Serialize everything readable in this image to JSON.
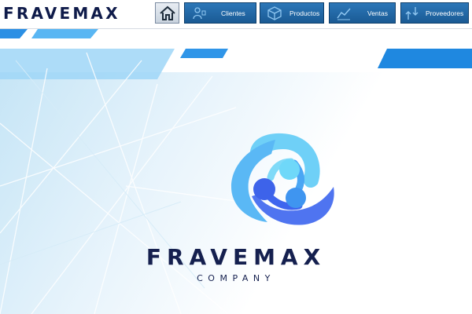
{
  "app": {
    "brand": "FRAVEMAX"
  },
  "nav": {
    "home_icon": "home-icon",
    "buttons": [
      {
        "label": "Clientes",
        "icon": "clients-icon"
      },
      {
        "label": "Productos",
        "icon": "box-icon"
      },
      {
        "label": "Ventas",
        "icon": "chart-icon"
      },
      {
        "label": "Proveedores",
        "icon": "suppliers-icon"
      }
    ]
  },
  "main": {
    "logo_name": "FRAVEMAX",
    "logo_tagline": "COMPANY"
  },
  "colors": {
    "brand_navy": "#15204f",
    "nav_blue": "#1f66a3",
    "accent_light": "#63d3f7",
    "accent_blue": "#3a8ef0",
    "accent_indigo": "#4667f2"
  }
}
